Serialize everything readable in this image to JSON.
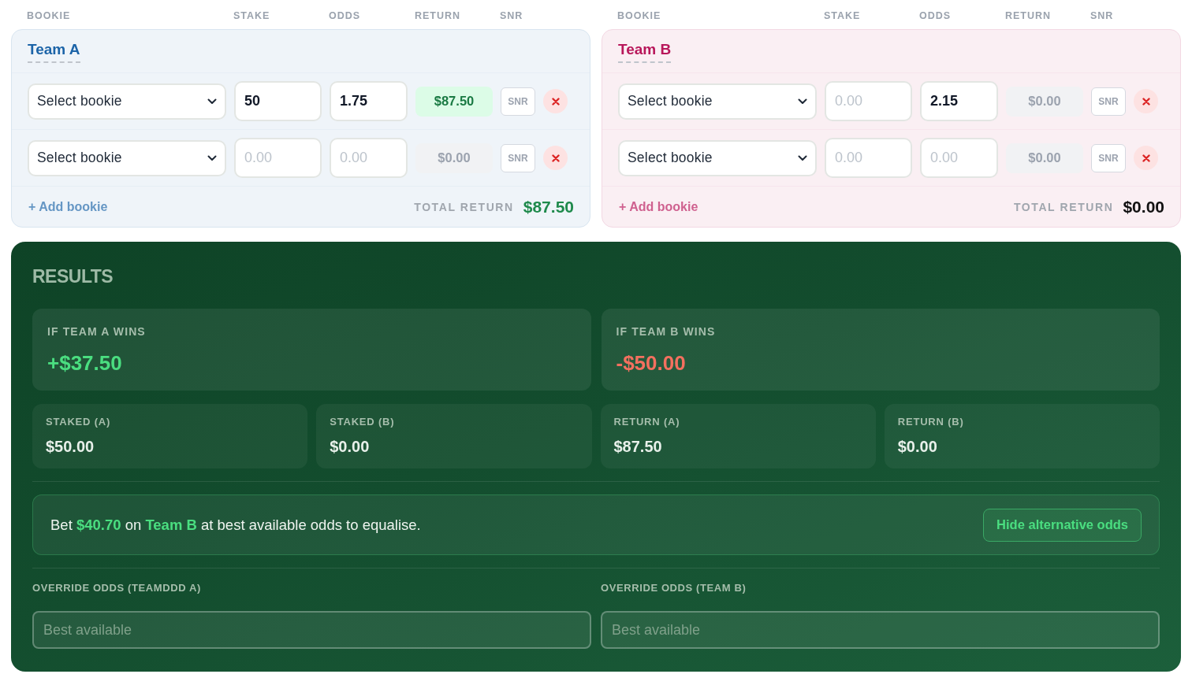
{
  "teams": [
    {
      "name": "Team A",
      "color": "#1c64a8",
      "columns": [
        "BOOKIE",
        "STAKE",
        "ODDS",
        "RETURN",
        "SNR"
      ],
      "rows": [
        {
          "bookie": "Select bookie",
          "stake": {
            "value": "50"
          },
          "odds": {
            "value": "1.75"
          },
          "return": "$87.50",
          "highlighted": true,
          "snr": "SNR"
        },
        {
          "bookie": "Select bookie",
          "stake": {
            "placeholder": "0.00"
          },
          "odds": {
            "placeholder": "0.00"
          },
          "return": "$0.00",
          "highlighted": false,
          "snr": "SNR"
        }
      ],
      "add_label": "+ Add bookie",
      "total_label": "TOTAL RETURN",
      "total": "$87.50",
      "total_highlighted": true
    },
    {
      "name": "Team B",
      "color": "#b8175a",
      "columns": [
        "BOOKIE",
        "STAKE",
        "ODDS",
        "RETURN",
        "SNR"
      ],
      "rows": [
        {
          "bookie": "Select bookie",
          "stake": {
            "placeholder": "0.00"
          },
          "odds": {
            "value": "2.15"
          },
          "return": "$0.00",
          "highlighted": false,
          "snr": "SNR"
        },
        {
          "bookie": "Select bookie",
          "stake": {
            "placeholder": "0.00"
          },
          "odds": {
            "placeholder": "0.00"
          },
          "return": "$0.00",
          "highlighted": false,
          "snr": "SNR"
        }
      ],
      "add_label": "+ Add bookie",
      "total_label": "TOTAL RETURN",
      "total": "$0.00",
      "total_highlighted": false
    }
  ],
  "results": {
    "title": "RESULTS",
    "outcomes": [
      {
        "label": "IF TEAM A WINS",
        "value": "+$37.50",
        "kind": "gain"
      },
      {
        "label": "IF TEAM B WINS",
        "value": "-$50.00",
        "kind": "loss"
      }
    ],
    "stats": [
      {
        "label": "STAKED (A)",
        "value": "$50.00"
      },
      {
        "label": "STAKED (B)",
        "value": "$0.00"
      },
      {
        "label": "RETURN (A)",
        "value": "$87.50"
      },
      {
        "label": "RETURN (B)",
        "value": "$0.00"
      }
    ],
    "equalise": {
      "text": "Bet **$40.70** on **Team B** at best available odds to equalise.",
      "button": "Hide alternative odds"
    },
    "overrides": [
      {
        "label": "OVERRIDE ODDS (TEAMDDD A)",
        "placeholder": "Best available"
      },
      {
        "label": "OVERRIDE ODDS (TEAM B)",
        "placeholder": "Best available"
      }
    ]
  }
}
